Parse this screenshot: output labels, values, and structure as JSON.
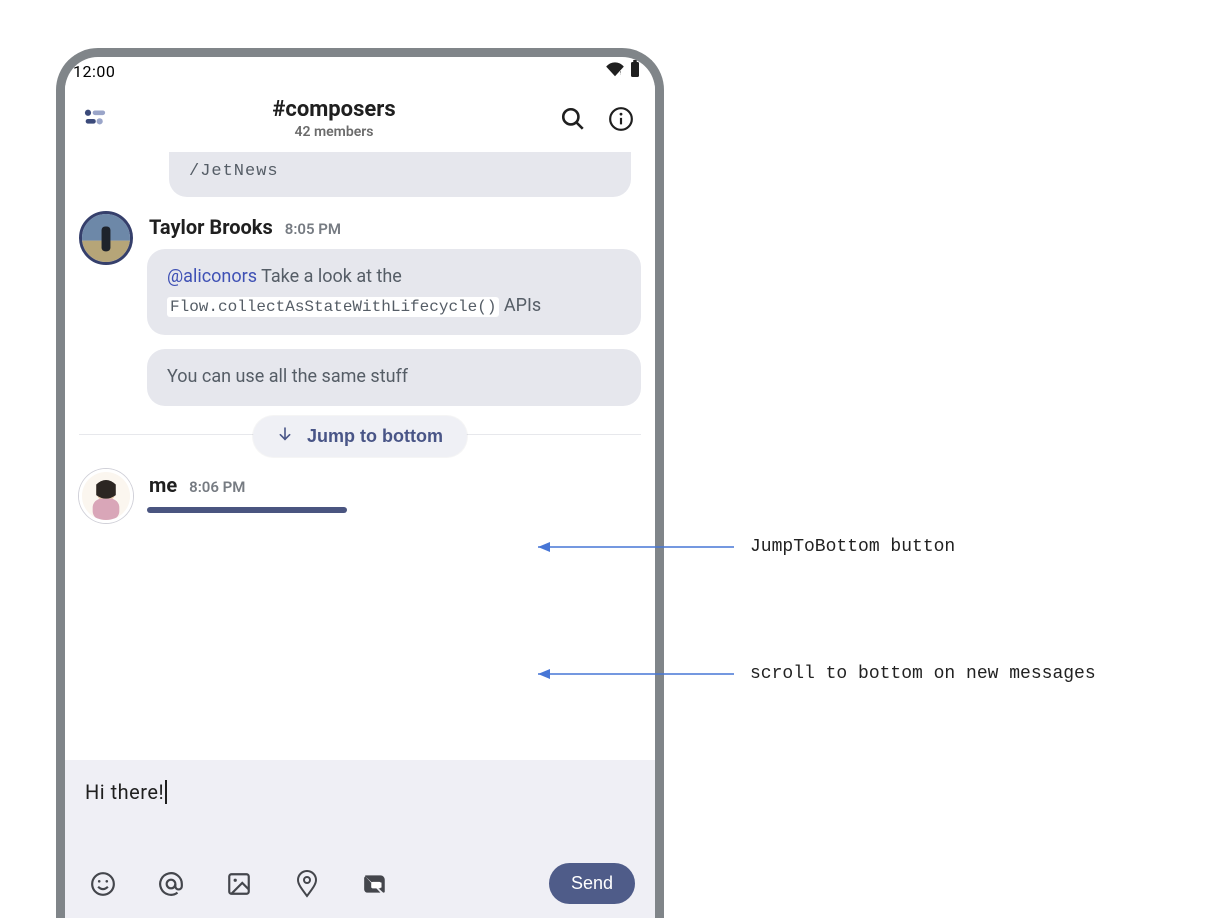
{
  "statusbar": {
    "time": "12:00"
  },
  "header": {
    "channel": "#composers",
    "members": "42 members"
  },
  "messages": {
    "prev_bubble_text": "/JetNews",
    "taylor": {
      "name": "Taylor Brooks",
      "time": "8:05 PM",
      "msg1_mention": "@aliconors",
      "msg1_text_before": " Take a look at the ",
      "msg1_code": "Flow.collectAsStateWithLifecycle()",
      "msg1_text_after": " APIs",
      "msg2": "You can use all the same stuff"
    },
    "jump_label": "Jump to bottom",
    "me": {
      "name": "me",
      "time": "8:06 PM"
    }
  },
  "composer": {
    "value": "Hi there!",
    "send_label": "Send"
  },
  "annotations": {
    "jump": "JumpToBottom button",
    "scroll": "scroll to bottom on new messages"
  }
}
